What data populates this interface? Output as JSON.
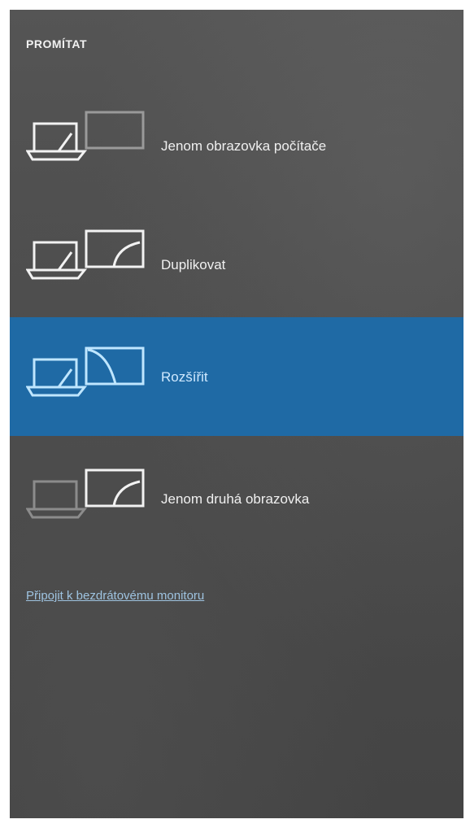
{
  "panel": {
    "title": "PROMÍTAT"
  },
  "options": [
    {
      "label": "Jenom obrazovka počítače",
      "icon": "pc-screen-only-icon",
      "selected": false
    },
    {
      "label": "Duplikovat",
      "icon": "duplicate-icon",
      "selected": false
    },
    {
      "label": "Rozšířit",
      "icon": "extend-icon",
      "selected": true
    },
    {
      "label": "Jenom druhá obrazovka",
      "icon": "second-screen-only-icon",
      "selected": false
    }
  ],
  "link": {
    "label": "Připojit k bezdrátovému monitoru"
  },
  "colors": {
    "panel_background": "#4a4a4a",
    "selected_background": "#1f6aa5",
    "selected_icon": "#bfe6ff",
    "link": "#9ec3e0"
  }
}
